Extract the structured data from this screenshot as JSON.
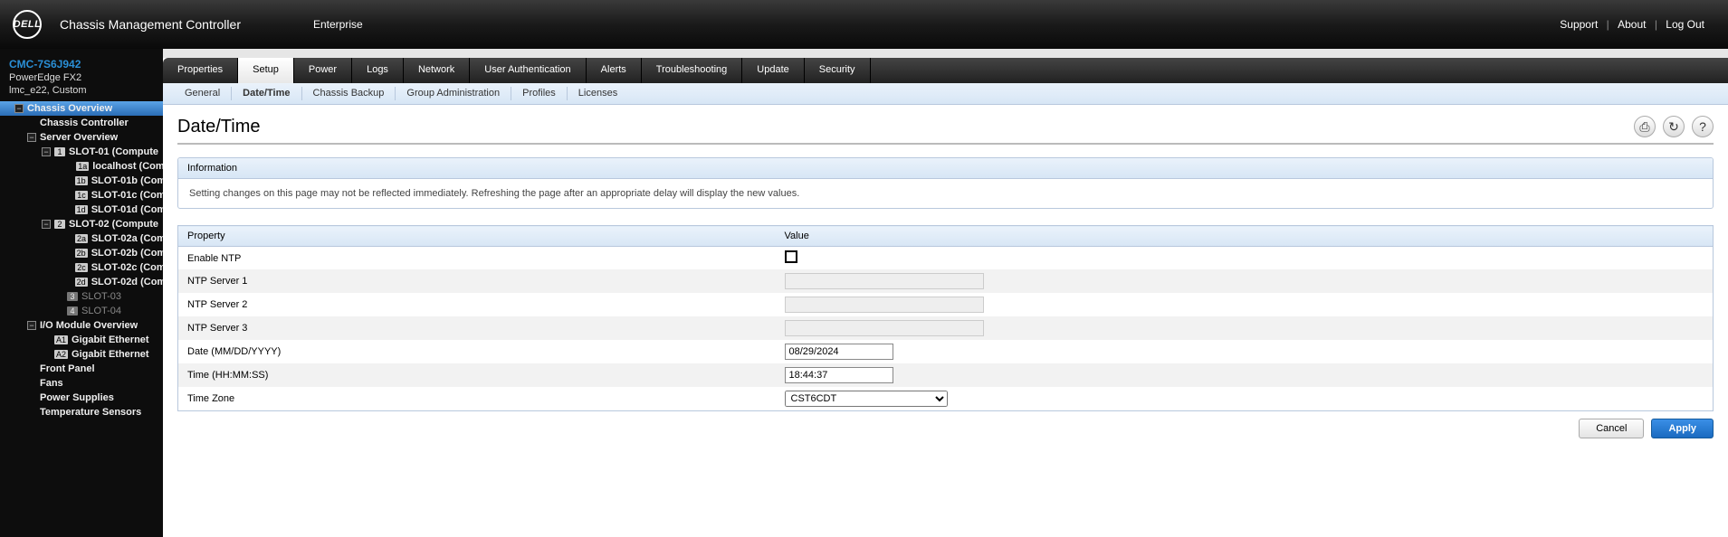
{
  "brand": {
    "logo_text": "DELL",
    "title": "Chassis Management Controller",
    "subtitle": "Enterprise",
    "links": {
      "support": "Support",
      "about": "About",
      "logout": "Log Out"
    }
  },
  "sidebar": {
    "device": "CMC-7S6J942",
    "model": "PowerEdge FX2",
    "user": "lmc_e22, Custom",
    "tree": {
      "root": "Chassis Overview",
      "controller": "Chassis Controller",
      "server_overview": "Server Overview",
      "slot1": {
        "num": "1",
        "label": "SLOT-01 (Compute",
        "c": [
          {
            "b": "1a",
            "l": "localhost (Com"
          },
          {
            "b": "1b",
            "l": "SLOT-01b (Com"
          },
          {
            "b": "1c",
            "l": "SLOT-01c (Com"
          },
          {
            "b": "1d",
            "l": "SLOT-01d (Com"
          }
        ]
      },
      "slot2": {
        "num": "2",
        "label": "SLOT-02 (Compute",
        "c": [
          {
            "b": "2a",
            "l": "SLOT-02a (Com"
          },
          {
            "b": "2b",
            "l": "SLOT-02b (Com"
          },
          {
            "b": "2c",
            "l": "SLOT-02c (Com"
          },
          {
            "b": "2d",
            "l": "SLOT-02d (Com"
          }
        ]
      },
      "slot3": {
        "num": "3",
        "label": "SLOT-03"
      },
      "slot4": {
        "num": "4",
        "label": "SLOT-04"
      },
      "iomod": "I/O Module Overview",
      "io": [
        {
          "b": "A1",
          "l": "Gigabit Ethernet"
        },
        {
          "b": "A2",
          "l": "Gigabit Ethernet"
        }
      ],
      "front_panel": "Front Panel",
      "fans": "Fans",
      "power_supplies": "Power Supplies",
      "temp": "Temperature Sensors"
    }
  },
  "tabs": [
    "Properties",
    "Setup",
    "Power",
    "Logs",
    "Network",
    "User Authentication",
    "Alerts",
    "Troubleshooting",
    "Update",
    "Security"
  ],
  "active_tab": "Setup",
  "subtabs": [
    "General",
    "Date/Time",
    "Chassis Backup",
    "Group Administration",
    "Profiles",
    "Licenses"
  ],
  "active_subtab": "Date/Time",
  "page": {
    "title": "Date/Time",
    "info_head": "Information",
    "info_body": "Setting changes on this page may not be reflected immediately. Refreshing the page after an appropriate delay will display the new values.",
    "col_property": "Property",
    "col_value": "Value",
    "rows": {
      "enable_ntp": "Enable NTP",
      "ntp1": "NTP Server 1",
      "ntp2": "NTP Server 2",
      "ntp3": "NTP Server 3",
      "date": "Date (MM/DD/YYYY)",
      "time": "Time (HH:MM:SS)",
      "tz": "Time Zone"
    },
    "values": {
      "enable_ntp": false,
      "ntp1": "",
      "ntp2": "",
      "ntp3": "",
      "date": "08/29/2024",
      "time": "18:44:37",
      "tz": "CST6CDT"
    },
    "buttons": {
      "cancel": "Cancel",
      "apply": "Apply"
    }
  }
}
